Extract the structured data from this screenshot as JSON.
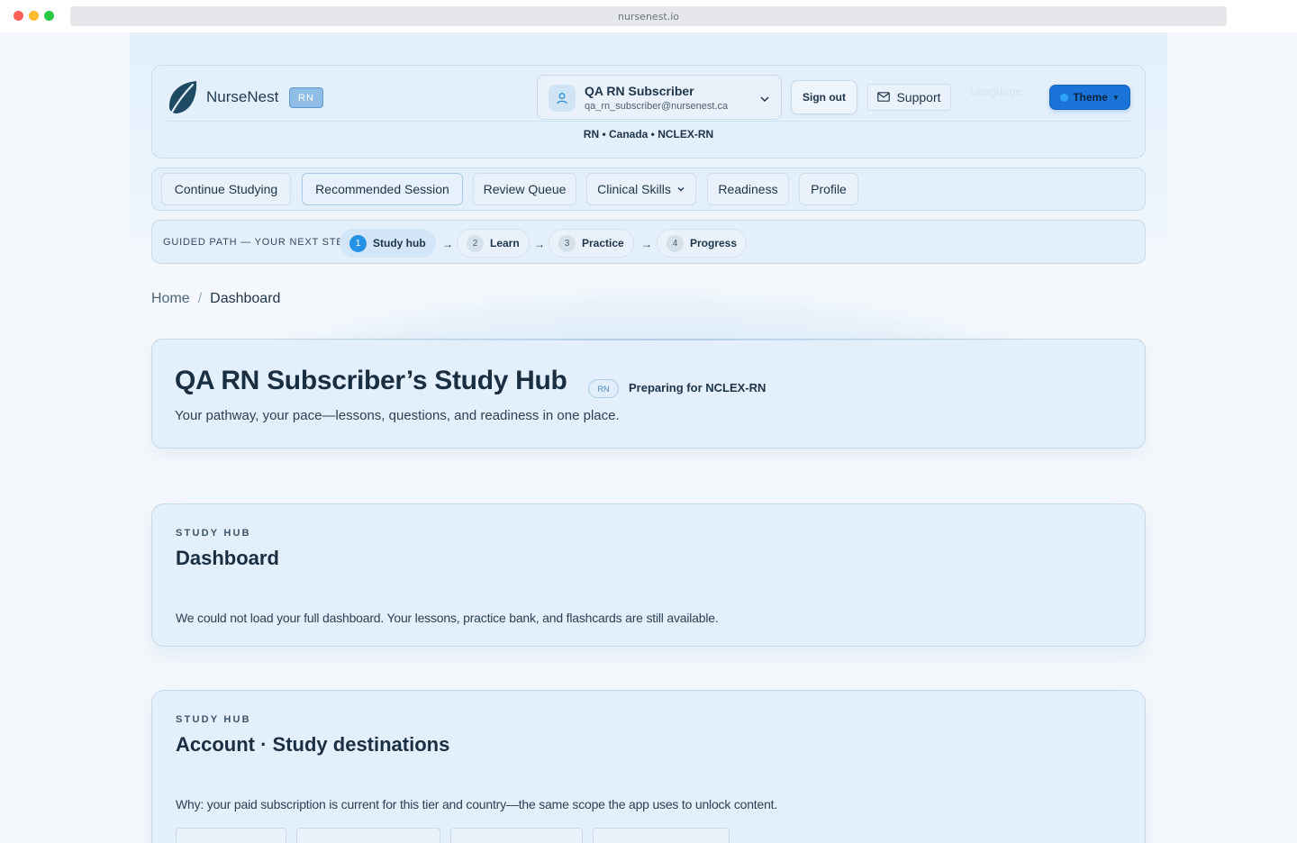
{
  "browser": {
    "url": "nursenest.io"
  },
  "brand": {
    "name": "NurseNest",
    "badge": "RN"
  },
  "account": {
    "name": "QA RN Subscriber",
    "email": "qa_rn_subscriber@nursenest.ca"
  },
  "header": {
    "signout_label": "Sign out",
    "support_label": "Support",
    "language_label": "Language",
    "theme_label": "Theme",
    "region": "RN • Canada • NCLEX-RN"
  },
  "nav": {
    "items": [
      {
        "label": "Continue Studying"
      },
      {
        "label": "Recommended Session"
      },
      {
        "label": "Review Queue"
      },
      {
        "label": "Clinical Skills"
      },
      {
        "label": "Readiness"
      },
      {
        "label": "Profile"
      }
    ]
  },
  "guided_path": {
    "label": "GUIDED PATH — YOUR NEXT STEP",
    "steps": [
      {
        "num": "1",
        "label": "Study hub"
      },
      {
        "num": "2",
        "label": "Learn"
      },
      {
        "num": "3",
        "label": "Practice"
      },
      {
        "num": "4",
        "label": "Progress"
      }
    ],
    "arrow": "→"
  },
  "breadcrumb": {
    "home": "Home",
    "separator": "/",
    "current": "Dashboard"
  },
  "hero": {
    "title": "QA RN Subscriber’s Study Hub",
    "badge": "RN",
    "preparing": "Preparing for NCLEX-RN",
    "subtitle": "Your pathway, your pace—lessons, questions, and readiness in one place."
  },
  "sections": [
    {
      "eyebrow": "STUDY HUB",
      "title": "Dashboard",
      "text": "We could not load your full dashboard. Your lessons, practice bank, and flashcards are still available."
    },
    {
      "eyebrow": "STUDY HUB",
      "title": "Account · Study destinations",
      "text": "Why: your paid subscription is current for this tier and country—the same scope the app uses to unlock content."
    }
  ],
  "colors": {
    "accent": "#1a74d8",
    "step_active": "#2493e6",
    "page_bg": "#f4f8fc",
    "card_bg": "#e3effa"
  },
  "icons": {
    "logo": "leaf-logo",
    "account": "user-icon",
    "support": "mail-icon",
    "chevron": "chevron-down-icon"
  }
}
